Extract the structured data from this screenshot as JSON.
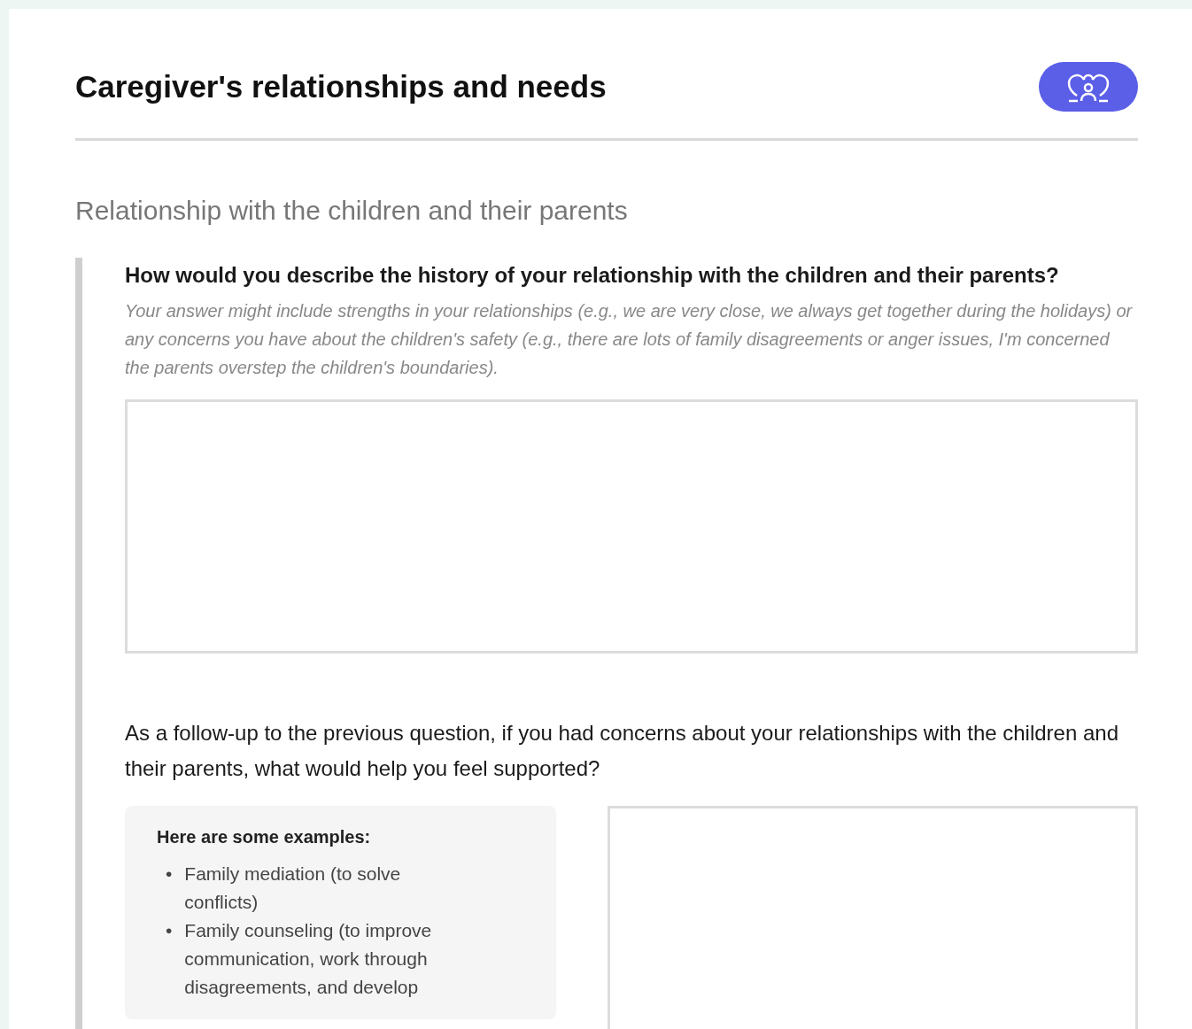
{
  "header": {
    "title": "Caregiver's relationships and needs"
  },
  "section": {
    "title": "Relationship with the children and their parents",
    "questions": [
      {
        "kind": "text",
        "question": "How would you describe the history of your relationship with the children and their parents?",
        "hint": "Your answer might include strengths in your relationships (e.g., we are very close, we always get together during the holidays) or any concerns you have about the children's safety (e.g., there are lots of family disagreements or anger issues, I'm concerned the parents overstep the children's boundaries)."
      },
      {
        "kind": "examples",
        "question": "As a follow-up to the previous question, if you had concerns about your relationships with the children and their parents, what would help you feel supported?",
        "examples_title": "Here are some examples:",
        "bullet": "•",
        "examples": [
          "Family mediation (to solve conflicts)",
          "Family counseling (to improve communication, work through disagreements, and develop"
        ]
      }
    ]
  }
}
